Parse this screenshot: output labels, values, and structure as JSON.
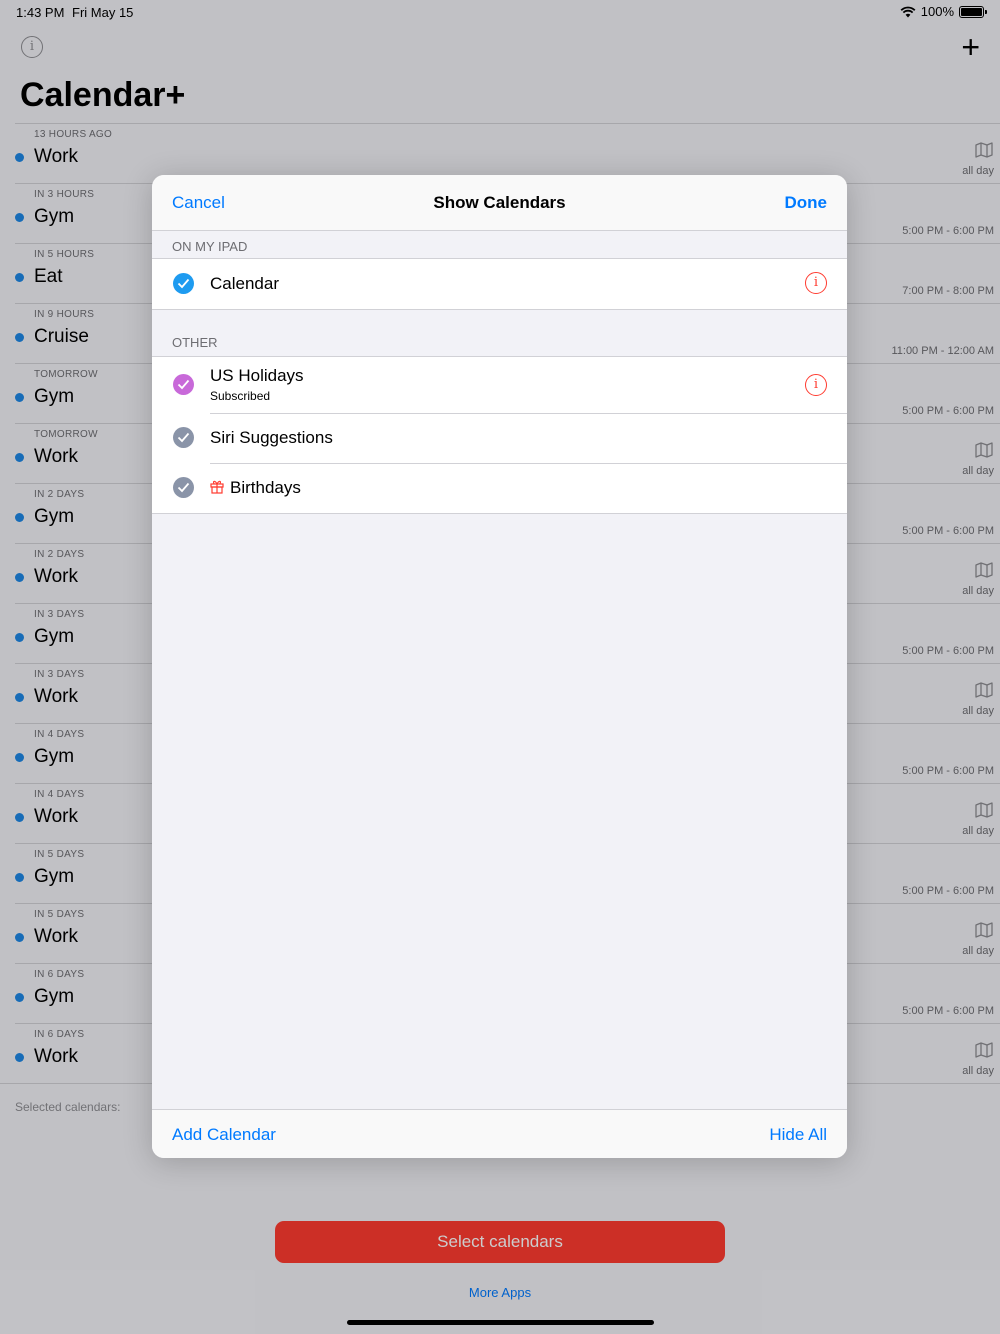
{
  "status_bar": {
    "time": "1:43 PM",
    "date": "Fri May 15",
    "battery": "100%"
  },
  "app": {
    "title": "Calendar+",
    "info_icon": "i",
    "add_icon": "+"
  },
  "events": [
    {
      "when": "13 HOURS AGO",
      "name": "Work",
      "time": "all day",
      "has_map": true
    },
    {
      "when": "IN 3 HOURS",
      "name": "Gym",
      "time": "5:00 PM - 6:00 PM",
      "has_map": false
    },
    {
      "when": "IN 5 HOURS",
      "name": "Eat",
      "time": "7:00 PM - 8:00 PM",
      "has_map": false
    },
    {
      "when": "IN 9 HOURS",
      "name": "Cruise",
      "time": "11:00 PM - 12:00 AM",
      "has_map": false
    },
    {
      "when": "TOMORROW",
      "name": "Gym",
      "time": "5:00 PM - 6:00 PM",
      "has_map": false
    },
    {
      "when": "TOMORROW",
      "name": "Work",
      "time": "all day",
      "has_map": true
    },
    {
      "when": "IN 2 DAYS",
      "name": "Gym",
      "time": "5:00 PM - 6:00 PM",
      "has_map": false
    },
    {
      "when": "IN 2 DAYS",
      "name": "Work",
      "time": "all day",
      "has_map": true
    },
    {
      "when": "IN 3 DAYS",
      "name": "Gym",
      "time": "5:00 PM - 6:00 PM",
      "has_map": false
    },
    {
      "when": "IN 3 DAYS",
      "name": "Work",
      "time": "all day",
      "has_map": true
    },
    {
      "when": "IN 4 DAYS",
      "name": "Gym",
      "time": "5:00 PM - 6:00 PM",
      "has_map": false
    },
    {
      "when": "IN 4 DAYS",
      "name": "Work",
      "time": "all day",
      "has_map": true
    },
    {
      "when": "IN 5 DAYS",
      "name": "Gym",
      "time": "5:00 PM - 6:00 PM",
      "has_map": false
    },
    {
      "when": "IN 5 DAYS",
      "name": "Work",
      "time": "all day",
      "has_map": true
    },
    {
      "when": "IN 6 DAYS",
      "name": "Gym",
      "time": "5:00 PM - 6:00 PM",
      "has_map": false
    },
    {
      "when": "IN 6 DAYS",
      "name": "Work",
      "time": "all day",
      "has_map": true
    }
  ],
  "footer": {
    "selected_calendars": "Selected calendars:",
    "select_button": "Select calendars",
    "more_apps": "More Apps"
  },
  "modal": {
    "cancel": "Cancel",
    "title": "Show Calendars",
    "done": "Done",
    "section_ipad": "ON MY IPAD",
    "section_other": "OTHER",
    "calendars_ipad": [
      {
        "name": "Calendar",
        "color": "#1e9bf0"
      }
    ],
    "calendars_other": [
      {
        "name": "US Holidays",
        "sub": "Subscribed",
        "color": "#c869d9"
      },
      {
        "name": "Siri Suggestions",
        "color": "#8a94a8"
      },
      {
        "name": "Birthdays",
        "color": "#8a94a8"
      }
    ],
    "add_calendar": "Add Calendar",
    "hide_all": "Hide All"
  },
  "colors": {
    "accent": "#007aff",
    "destructive": "#ff3b30"
  }
}
